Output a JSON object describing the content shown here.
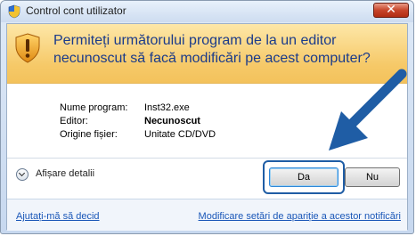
{
  "window": {
    "title": "Control cont utilizator",
    "close_glyph": "✕"
  },
  "header": {
    "line1": "Permiteți următorului program de la un editor",
    "line2": "necunoscut să facă modificări pe acest computer?",
    "icon": "shield-warning-icon"
  },
  "details": {
    "rows": [
      {
        "label": "Nume program:",
        "value": "Inst32.exe",
        "bold": false
      },
      {
        "label": "Editor:",
        "value": "Necunoscut",
        "bold": true
      },
      {
        "label": "Origine fișier:",
        "value": "Unitate CD/DVD",
        "bold": false
      }
    ]
  },
  "toggle": {
    "label": "Afișare detalii",
    "icon": "chevron-down-icon"
  },
  "buttons": {
    "yes": "Da",
    "no": "Nu"
  },
  "links": {
    "help": "Ajutați-mă să decid",
    "settings": "Modificare setări de apariție a acestor notificări"
  },
  "colors": {
    "accent_blue": "#1f5da5",
    "header_gold": "#f6c968",
    "heading_text": "#1b3b8a",
    "link": "#1a57b8"
  }
}
